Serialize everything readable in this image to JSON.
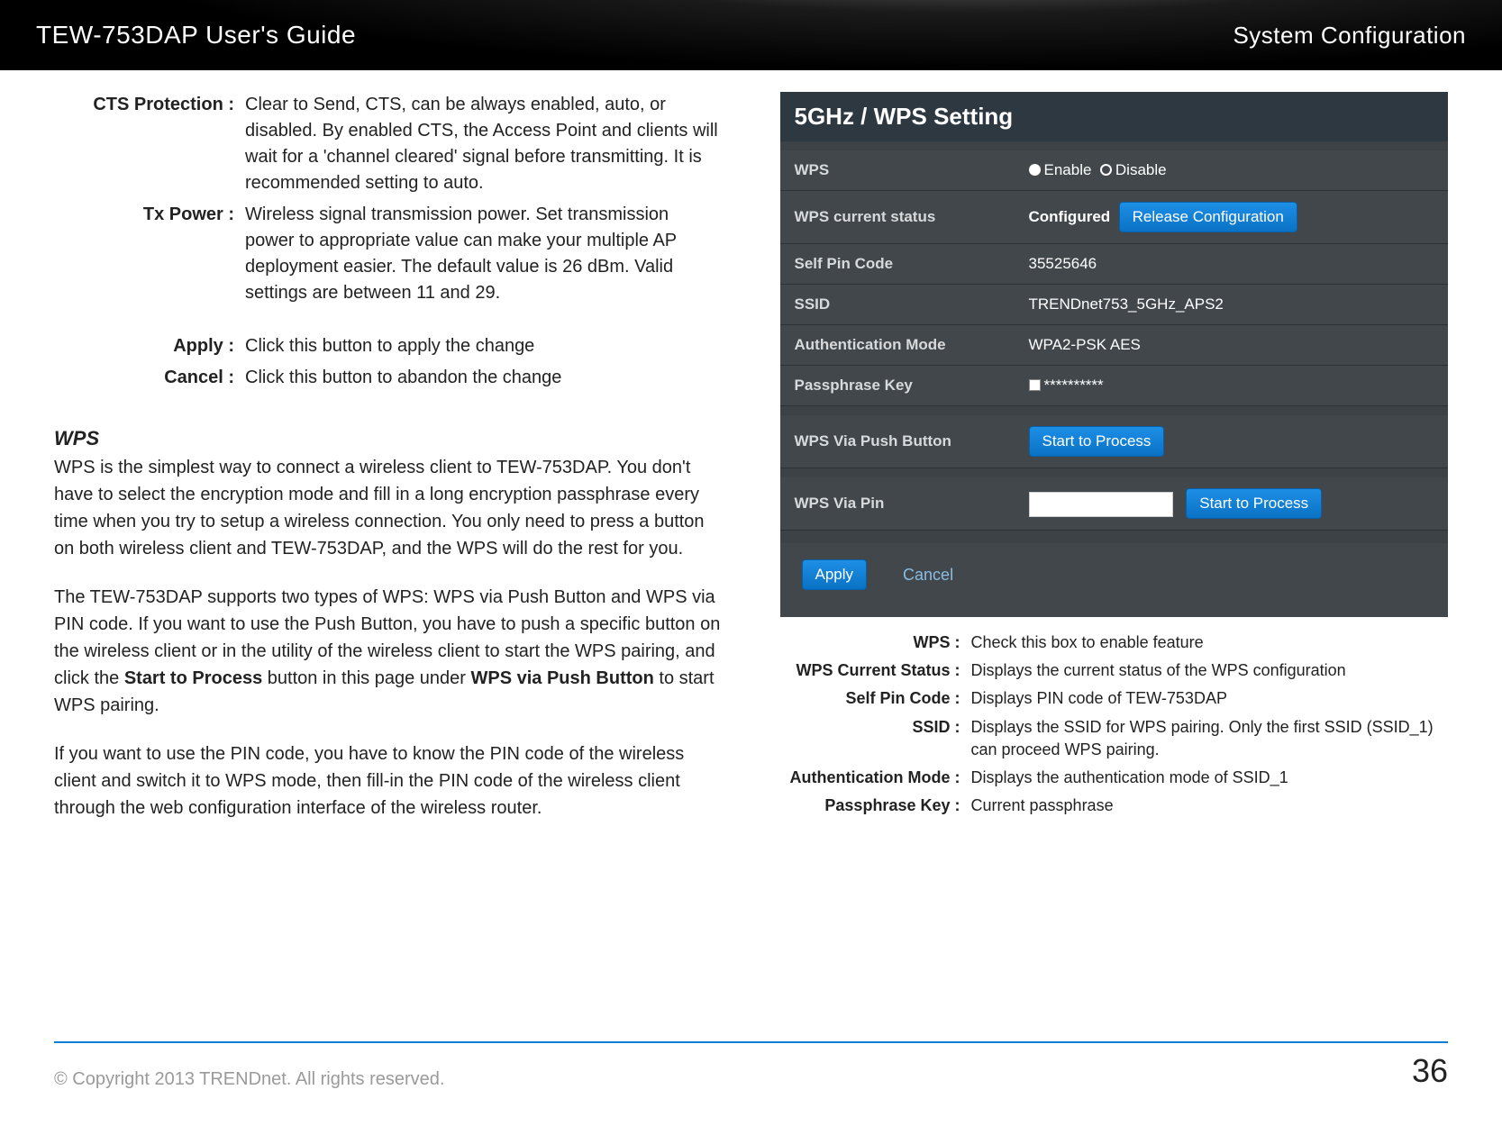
{
  "header": {
    "left_title": "TEW-753DAP User's Guide",
    "right_title": "System Configuration"
  },
  "left": {
    "defs_top": [
      {
        "label": "CTS Protection :",
        "value": "Clear to Send, CTS, can be always enabled, auto, or disabled. By enabled CTS, the Access Point and clients will wait for a 'channel cleared' signal before transmitting. It is recommended setting to auto."
      },
      {
        "label": "Tx Power :",
        "value": "Wireless signal transmission power. Set transmission power to appropriate value can make your multiple AP deployment easier.  The default value is 26 dBm. Valid settings are between 11 and 29."
      }
    ],
    "defs_mid": [
      {
        "label": "Apply :",
        "value": "Click this button to apply the change"
      },
      {
        "label": "Cancel :",
        "value": "Click this button to abandon the change"
      }
    ],
    "section_heading": "WPS",
    "para1": "WPS is the simplest way to connect a wireless client to TEW-753DAP. You don't have to select the encryption mode and fill in a long encryption passphrase every time when you try to setup a wireless connection. You only need to press a button on both wireless client and TEW-753DAP, and the WPS will do the rest for you.",
    "para2_a": "The TEW-753DAP supports two types of WPS: WPS via Push Button and WPS via PIN code. If you want to use the Push Button, you have to push a specific button on the wireless client or in the utility of the wireless client to start the WPS pairing, and click the ",
    "para2_b": "Start to Process",
    "para2_c": " button in this page under ",
    "para2_d": "WPS via Push Button",
    "para2_e": " to start WPS pairing.",
    "para3": "If you want to use the PIN code, you have to know the PIN code of the wireless client and switch it to WPS mode, then fill-in the PIN code of the wireless client through the web configuration interface of the wireless router."
  },
  "panel": {
    "title": "5GHz / WPS Setting",
    "rows": {
      "wps_label": "WPS",
      "wps_enable": "Enable",
      "wps_disable": "Disable",
      "status_label": "WPS current status",
      "status_value": "Configured",
      "release_btn": "Release Configuration",
      "selfpin_label": "Self Pin Code",
      "selfpin_value": "35525646",
      "ssid_label": "SSID",
      "ssid_value": "TRENDnet753_5GHz_APS2",
      "auth_label": "Authentication Mode",
      "auth_value": "WPA2-PSK AES",
      "pass_label": "Passphrase Key",
      "pass_value": "**********",
      "push_label": "WPS Via Push Button",
      "push_btn": "Start to Process",
      "pin_label": "WPS Via Pin",
      "pin_btn": "Start to Process"
    },
    "footer": {
      "apply": "Apply",
      "cancel": "Cancel"
    }
  },
  "right_defs": [
    {
      "label": "WPS :",
      "value": "Check this box to enable feature"
    },
    {
      "label": "WPS Current Status :",
      "value": "Displays the current status of the WPS configuration"
    },
    {
      "label": "Self Pin Code :",
      "value": "Displays PIN code of TEW-753DAP"
    },
    {
      "label": "SSID :",
      "value": "Displays the SSID for WPS pairing. Only the first SSID (SSID_1) can proceed WPS pairing."
    },
    {
      "label": "Authentication Mode :",
      "value": "Displays the authentication mode of SSID_1"
    },
    {
      "label": "Passphrase Key :",
      "value": "Current passphrase"
    }
  ],
  "footer": {
    "copyright": "© Copyright 2013 TRENDnet. All rights reserved.",
    "page_number": "36"
  }
}
